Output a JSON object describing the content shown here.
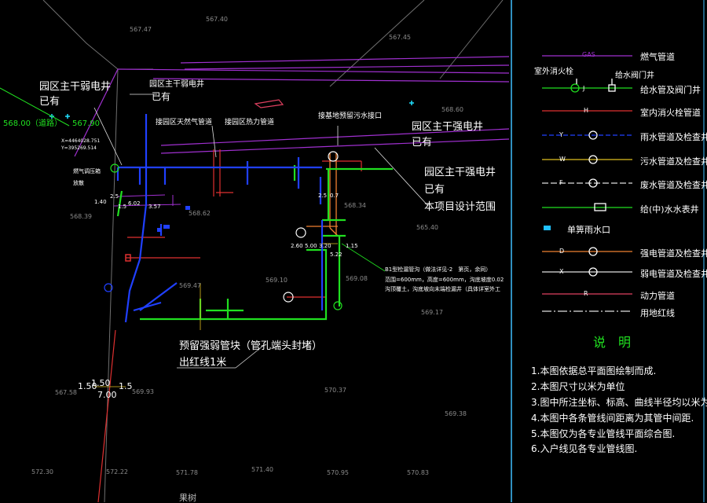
{
  "colors": {
    "background": "#000000",
    "gas": "#a030d0",
    "water_supply": "#20e020",
    "fire": "#e03030",
    "rain": "#2040ff",
    "sewage": "#e0c020",
    "drain": "#e0e0e0",
    "strong_power": "#f08030",
    "weak_power": "#e0e0e0",
    "power": "#e04060",
    "border": "#40c0ff"
  },
  "callouts": {
    "weak_well_left": {
      "title": "园区主干弱电井",
      "status": "已有"
    },
    "weak_well_top": {
      "title": "园区主干弱电井",
      "status": "已有"
    },
    "strong_well": {
      "title": "园区主干强电井",
      "status": "已有"
    },
    "strong_well_right": {
      "title": "园区主干强电井",
      "status": "已有",
      "scope": "本项目设计范围"
    },
    "conduit_block": {
      "line1": "预留强弱管块（管孔端头封堵）",
      "line2": "出红线1米"
    }
  },
  "tap_labels": {
    "gas": "接园区天然气管道",
    "heat": "接园区热力管道",
    "sewage": "接基地预留污水接口",
    "gas_valve": "燃气调压箱",
    "vent": "放散"
  },
  "pit_note": {
    "line1": "B1型检漏管沟（做法详见-2　第页，余同）",
    "line2": "范围=600mm，高度=600mm，沟底坡度0.02",
    "line3": "沟顶覆土，沟底坡向末端检漏井（具体详室外工"
  },
  "road_label": "568.00（道路）",
  "level_label": "567.90",
  "coord": {
    "x": "X=4464028.751",
    "y": "Y=395269.514"
  },
  "bottom_label": "果树",
  "elevations": [
    "567.40",
    "567.47",
    "567.45",
    "568.60",
    "568.39",
    "568.62",
    "568.34",
    "565.40",
    "569.10",
    "569.08",
    "569.17",
    "569.93",
    "570.37",
    "569.38",
    "572.30",
    "572.22",
    "571.78",
    "571.40",
    "570.95",
    "570.83",
    "569.47",
    "567.58"
  ],
  "dims": {
    "d1": "1.50",
    "d2": "1.50",
    "d3": "7.00",
    "d4": "1.5",
    "d5": "2.60",
    "d6": "5.00",
    "d7": "3.20",
    "d8": "1.15",
    "d9": "5.22",
    "d10": "2.5",
    "d11": "0.7",
    "d12": "1.40",
    "d13": "2.5",
    "d14": "6.02",
    "d15": "3.57",
    "d16": "1.5"
  },
  "legend": {
    "hydrant": "室外消火栓",
    "valve_well": "给水阀门井",
    "items": [
      {
        "code": "GAS",
        "label": "燃气管道"
      },
      {
        "code": "J",
        "label": "给水管及阀门井"
      },
      {
        "code": "H",
        "label": "室内消火栓管道"
      },
      {
        "code": "Y",
        "label": "雨水管道及检查井"
      },
      {
        "code": "W",
        "label": "污水管道及检查井"
      },
      {
        "code": "F",
        "label": "废水管道及检查井"
      },
      {
        "code": "",
        "label": "给(中)水水表井"
      },
      {
        "code": "",
        "label": "单箅雨水口"
      },
      {
        "code": "D",
        "label": "强电管道及检查井"
      },
      {
        "code": "X",
        "label": "弱电管道及检查井"
      },
      {
        "code": "R",
        "label": "动力管道"
      },
      {
        "code": "",
        "label": "用地红线"
      }
    ]
  },
  "notes": {
    "title": "说　明",
    "lines": [
      "1.本图依据总平面图绘制而成.",
      "2.本图尺寸以米为单位",
      "3.图中所注坐标、标高、曲线半径均以米为单位.",
      "4.本图中各条管线间距离为其管中间距.",
      "5.本图仅为各专业管线平面综合图.",
      "6.入户线见各专业管线图."
    ]
  }
}
